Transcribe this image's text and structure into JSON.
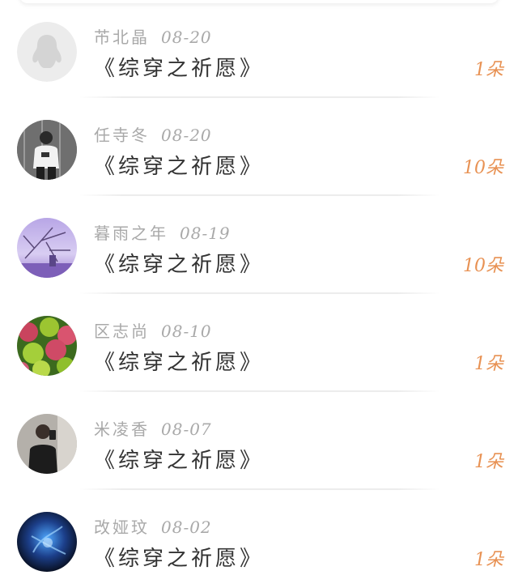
{
  "colors": {
    "accent": "#e89254",
    "name_gray": "#a9a9a9",
    "title_dark": "#333333"
  },
  "items": [
    {
      "name": "芇北晶",
      "date": "08-20",
      "title": "《综穿之祈愿》",
      "count": "1朵",
      "avatar": "default-penguin-avatar"
    },
    {
      "name": "任寺冬",
      "date": "08-20",
      "title": "《综穿之祈愿》",
      "count": "10朵",
      "avatar": "person-photo-avatar"
    },
    {
      "name": "暮雨之年",
      "date": "08-19",
      "title": "《综穿之祈愿》",
      "count": "10朵",
      "avatar": "purple-branches-avatar"
    },
    {
      "name": "区志尚",
      "date": "08-10",
      "title": "《综穿之祈愿》",
      "count": "1朵",
      "avatar": "rambutan-fruit-avatar"
    },
    {
      "name": "米凌香",
      "date": "08-07",
      "title": "《综穿之祈愿》",
      "count": "1朵",
      "avatar": "mirror-selfie-avatar"
    },
    {
      "name": "改娅玟",
      "date": "08-02",
      "title": "《综穿之祈愿》",
      "count": "1朵",
      "avatar": "blue-abstract-avatar"
    }
  ]
}
